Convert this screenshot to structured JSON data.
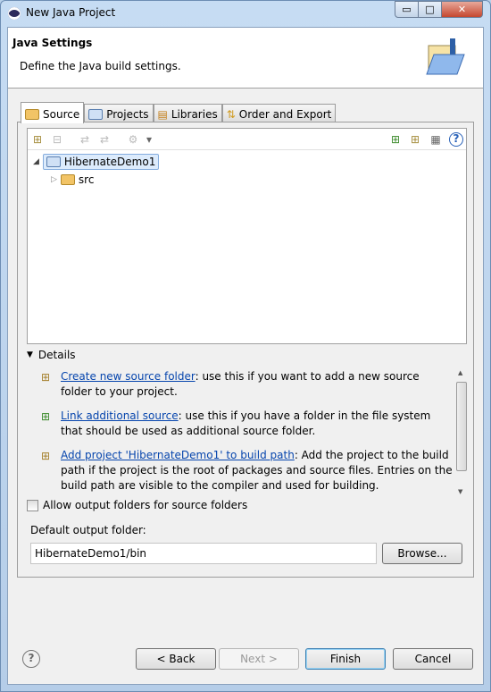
{
  "window": {
    "title": "New Java Project",
    "minimize": "▭",
    "maximize": "□",
    "close": "✕"
  },
  "header": {
    "title": "Java Settings",
    "description": "Define the Java build settings."
  },
  "tabs": [
    {
      "label": "Source",
      "icon": "source-folder-icon"
    },
    {
      "label": "Projects",
      "icon": "project-folder-icon"
    },
    {
      "label": "Libraries",
      "icon": "libraries-icon"
    },
    {
      "label": "Order and Export",
      "icon": "order-icon"
    }
  ],
  "tree": {
    "project": "HibernateDemo1",
    "children": [
      {
        "label": "src"
      }
    ]
  },
  "details": {
    "label": "Details",
    "items": [
      {
        "link": "Create new source folder",
        "text": ": use this if you want to add a new source folder to your project."
      },
      {
        "link": "Link additional source",
        "text": ": use this if you have a folder in the file system that should be used as additional source folder."
      },
      {
        "link": "Add project 'HibernateDemo1' to build path",
        "text": ": Add the project to the build path if the project is the root of packages and source files. Entries on the build path are visible to the compiler and used for building."
      }
    ]
  },
  "allow_output": {
    "label": "Allow output folders for source folders",
    "checked": false
  },
  "output": {
    "label": "Default output folder:",
    "value": "HibernateDemo1/bin",
    "browse": "Browse..."
  },
  "buttons": {
    "help": "?",
    "back": "< Back",
    "next": "Next >",
    "finish": "Finish",
    "cancel": "Cancel"
  }
}
